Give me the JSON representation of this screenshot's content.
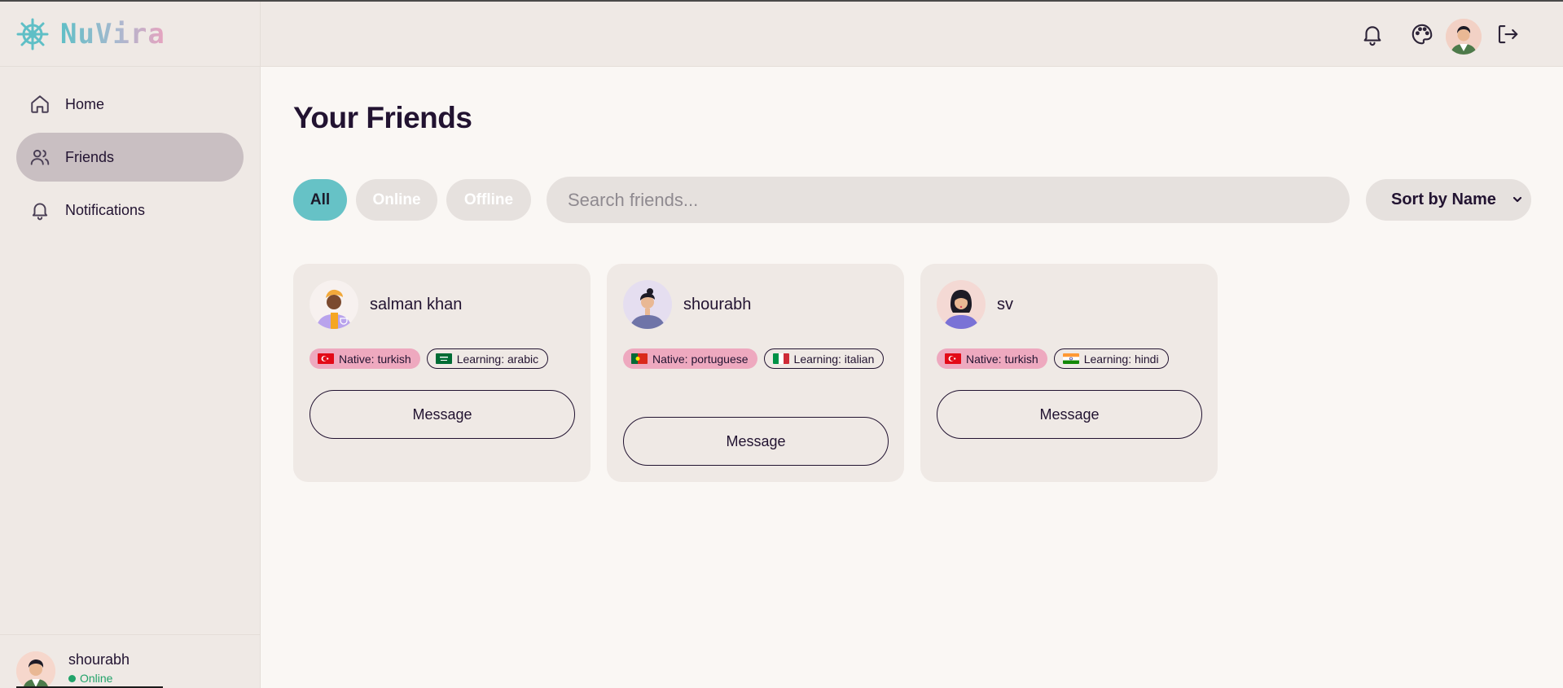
{
  "app": {
    "brand": "NuVira",
    "accent": "#66c2c6",
    "active_nav_bg": "#c9bfc2"
  },
  "sidebar": {
    "items": [
      {
        "label": "Home",
        "icon": "home-icon",
        "active": false
      },
      {
        "label": "Friends",
        "icon": "users-icon",
        "active": true
      },
      {
        "label": "Notifications",
        "icon": "bell-icon",
        "active": false
      }
    ],
    "user": {
      "name": "shourabh",
      "status": "Online"
    }
  },
  "header": {
    "icons": [
      "bell-icon",
      "palette-icon",
      "avatar",
      "logout-icon"
    ]
  },
  "main": {
    "title": "Your Friends",
    "filters": [
      {
        "label": "All",
        "active": true
      },
      {
        "label": "Online",
        "active": false
      },
      {
        "label": "Offline",
        "active": false
      }
    ],
    "search": {
      "placeholder": "Search friends...",
      "value": ""
    },
    "sort": {
      "label": "Sort by Name"
    },
    "friends": [
      {
        "name": "salman khan",
        "native": "Native: turkish",
        "native_flag": "turkey",
        "learning": "Learning: arabic",
        "learning_flag": "saudi-arabia",
        "button": "Message"
      },
      {
        "name": "shourabh",
        "native": "Native: portuguese",
        "native_flag": "portugal",
        "learning": "Learning: italian",
        "learning_flag": "italy",
        "button": "Message"
      },
      {
        "name": "sv",
        "native": "Native: turkish",
        "native_flag": "turkey",
        "learning": "Learning: hindi",
        "learning_flag": "india",
        "button": "Message"
      }
    ]
  }
}
